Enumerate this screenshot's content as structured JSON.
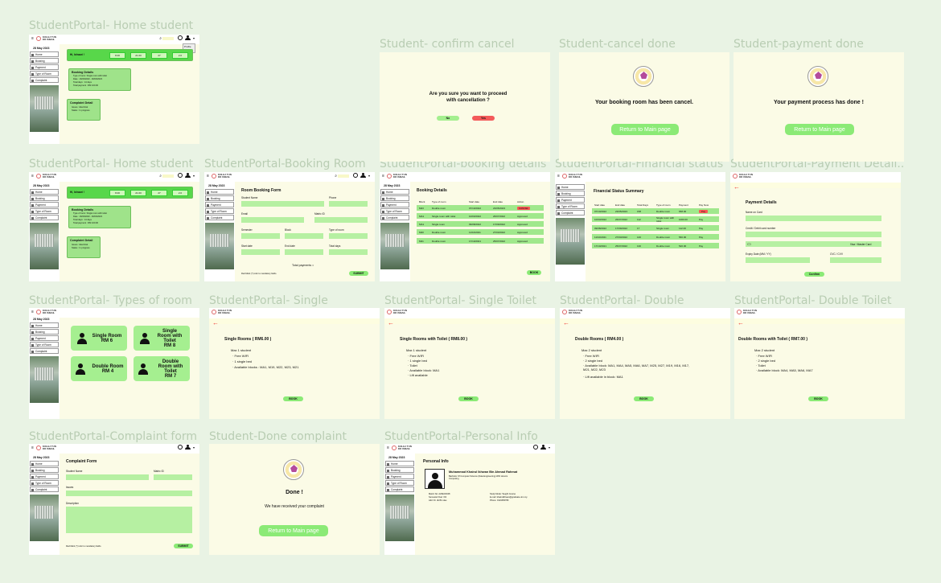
{
  "labels": {
    "home1": "StudentPortal- Home student",
    "confirm": "Student- confirm cancel",
    "canceldone": "Student-cancel done",
    "paydone": "Student-payment done",
    "home2": "StudentPortal- Home student",
    "booking": "StudentPortal-Booking Room",
    "bdetails": "StudentPortal-booking details",
    "finance": "StudentPortal-Financial status",
    "paydetail": "StudentPortal-Payment Detail...",
    "types": "StudentPortal- Types of room",
    "single": "StudentPortal- Single",
    "singletoilet": "StudentPortal- Single Toilet",
    "double": "StudentPortal- Double",
    "doubletoilet": "StudentPortal- Double Toilet",
    "complaint": "StudentPortal-Complaint form",
    "donecomplaint": "Student-Done complaint",
    "personal": "StudentPortal-Personal Info"
  },
  "common": {
    "college": "KOLEJ TUN DR ISMAIL",
    "date": "28 May 2023",
    "menu": [
      "Home",
      "Booking",
      "Payment",
      "Type of Room",
      "Complaint"
    ],
    "submit": "SUBMIT",
    "book": "BOOK",
    "return": "Return to Main page",
    "mandatory": "Red Mark (*) refer to mandatory fields."
  },
  "home": {
    "greeting": "Hi, Ishwari !",
    "stats": [
      "8.00",
      "21.00",
      "27",
      "2.0"
    ],
    "dropdown": [
      "Profile",
      "Log Out"
    ],
    "booking_title": "Booking Details",
    "booking_lines": [
      "Type of room: Single room with toilet",
      "Date : 16/03/2023 - 30/03/2023",
      "Total days : 14 days",
      "Total payment : RM 100.00"
    ],
    "complaint_title": "Complaint Detail",
    "complaint_lines": [
      "Issues : Electrical",
      "Status : In progress"
    ]
  },
  "confirm": {
    "question": "Are you sure you want to proceed with cancellation ?",
    "no": "No",
    "yes": "Yes"
  },
  "canceldone": {
    "message": "Your booking room has been cancel."
  },
  "paydone": {
    "message": "Your payment process has done !"
  },
  "bookingform": {
    "title": "Room Booking Form",
    "fields": [
      "Student Name",
      "Phone",
      "Email",
      "Matric ID",
      "Semester",
      "Block",
      "Type of room",
      "Start date",
      "End date",
      "Total days"
    ],
    "total": "Total payments ="
  },
  "bdetails": {
    "title": "Booking Details",
    "headers": [
      "Block",
      "Type of room",
      "Start date",
      "End date",
      "Action"
    ],
    "rows": [
      [
        "M23",
        "Double room",
        "07/10/2022",
        "23/05/2023",
        "CANCEL"
      ],
      [
        "MA1",
        "Single room with toilet",
        "10/03/2022",
        "26/07/2022",
        "Approved"
      ],
      [
        "MA1",
        "Single room",
        "09/08/2022",
        "17/09/2022",
        "Approved"
      ],
      [
        "M20",
        "Double room",
        "11/10/2021",
        "27/03/2022",
        "Approved"
      ],
      [
        "M21",
        "Double room",
        "17/10/2021",
        "25/07/2022",
        "Approved"
      ]
    ]
  },
  "finance": {
    "title": "Financial Status Summary",
    "headers": [
      "Start date",
      "End date",
      "Total Days",
      "Type of room",
      "Payment",
      "Pay Now"
    ],
    "rows": [
      [
        "07/10/2022",
        "23/05/2023",
        "158",
        "Double room",
        "658.00",
        "Pay"
      ],
      [
        "10/03/2022",
        "26/07/2022",
        "112",
        "Single room with toilet",
        "1000.00",
        "Pay"
      ],
      [
        "09/08/2022",
        "17/09/2022",
        "17",
        "Single room",
        "112.00",
        "Pay"
      ],
      [
        "11/10/2021",
        "27/03/2022",
        "140",
        "Double room",
        "560.00",
        "Pay"
      ],
      [
        "17/10/2021",
        "25/07/2022",
        "130",
        "Double room",
        "520.00",
        "Pay"
      ]
    ]
  },
  "payment": {
    "title": "Payment Details",
    "name": "Name on Card",
    "card": "Credit / Debit card number",
    "visa": "Visa / Master Card",
    "expiry": "Expiry Date (MM / YY)",
    "cvc": "CVC / CVV",
    "confirm": "Confirm"
  },
  "types": {
    "tiles": [
      {
        "name": "Single Room",
        "price": "RM 6"
      },
      {
        "name": "Single Room with Toilet",
        "price": "RM 8"
      },
      {
        "name": "Double Room",
        "price": "RM 4"
      },
      {
        "name": "Double Room with Toilet",
        "price": "RM 7"
      }
    ]
  },
  "single": {
    "title": "Single Rooms ( RM6.00 )",
    "max": "Max 1 student",
    "items": [
      "Free WIFI",
      "1 single bed",
      "Available blocks : MA1, M19, M22, M23, M21"
    ]
  },
  "singletoilet": {
    "title": "Single Rooms with Toilet ( RM8.00 )",
    "max": "Max 1 student",
    "items": [
      "Free WIFI",
      "1 single bed",
      "Toilet",
      "Available block: MA1",
      "Lift available"
    ]
  },
  "double": {
    "title": "Double Rooms ( RM4.00 )",
    "max": "Max 2 student",
    "items": [
      "Free WIFI",
      "2 single bed",
      "Available block: MA1, MA4, MA5, MA6, MA7, M25, M27, M19, M16, M17, M21, M22, M23",
      "Lift available in block: MA1"
    ]
  },
  "doubletoilet": {
    "title": "Double Rooms with Toilet ( RM7.00 )",
    "max": "Max 2 student",
    "items": [
      "Free WIFI",
      "2 single bed",
      "Toilet",
      "Available block: MA4, MA5, MA6, MA7"
    ]
  },
  "complaint": {
    "title": "Complaint Form",
    "name": "Student Name",
    "matric": "Matric ID",
    "issues": "Issues",
    "desc": "Description"
  },
  "donecomplaint": {
    "done": "Done !",
    "msg": "We have received your complaint"
  },
  "personal": {
    "title": "Personal Info",
    "name": "Muhammad Khairul Ikhwan Bin Ahmad Rahmat",
    "course": "Bachelor Of Computer Science (Data Engineering) With Honors Computing",
    "left": [
      "Matric No: A20EC0048",
      "Semester/Year: 6/3",
      "Add: Dr. dk Bin dau"
    ],
    "right": [
      "Study Mode: Taught Course",
      "E-mail: khairulikhwan@graduate.utm.my",
      "Phone: 0123456789"
    ]
  }
}
